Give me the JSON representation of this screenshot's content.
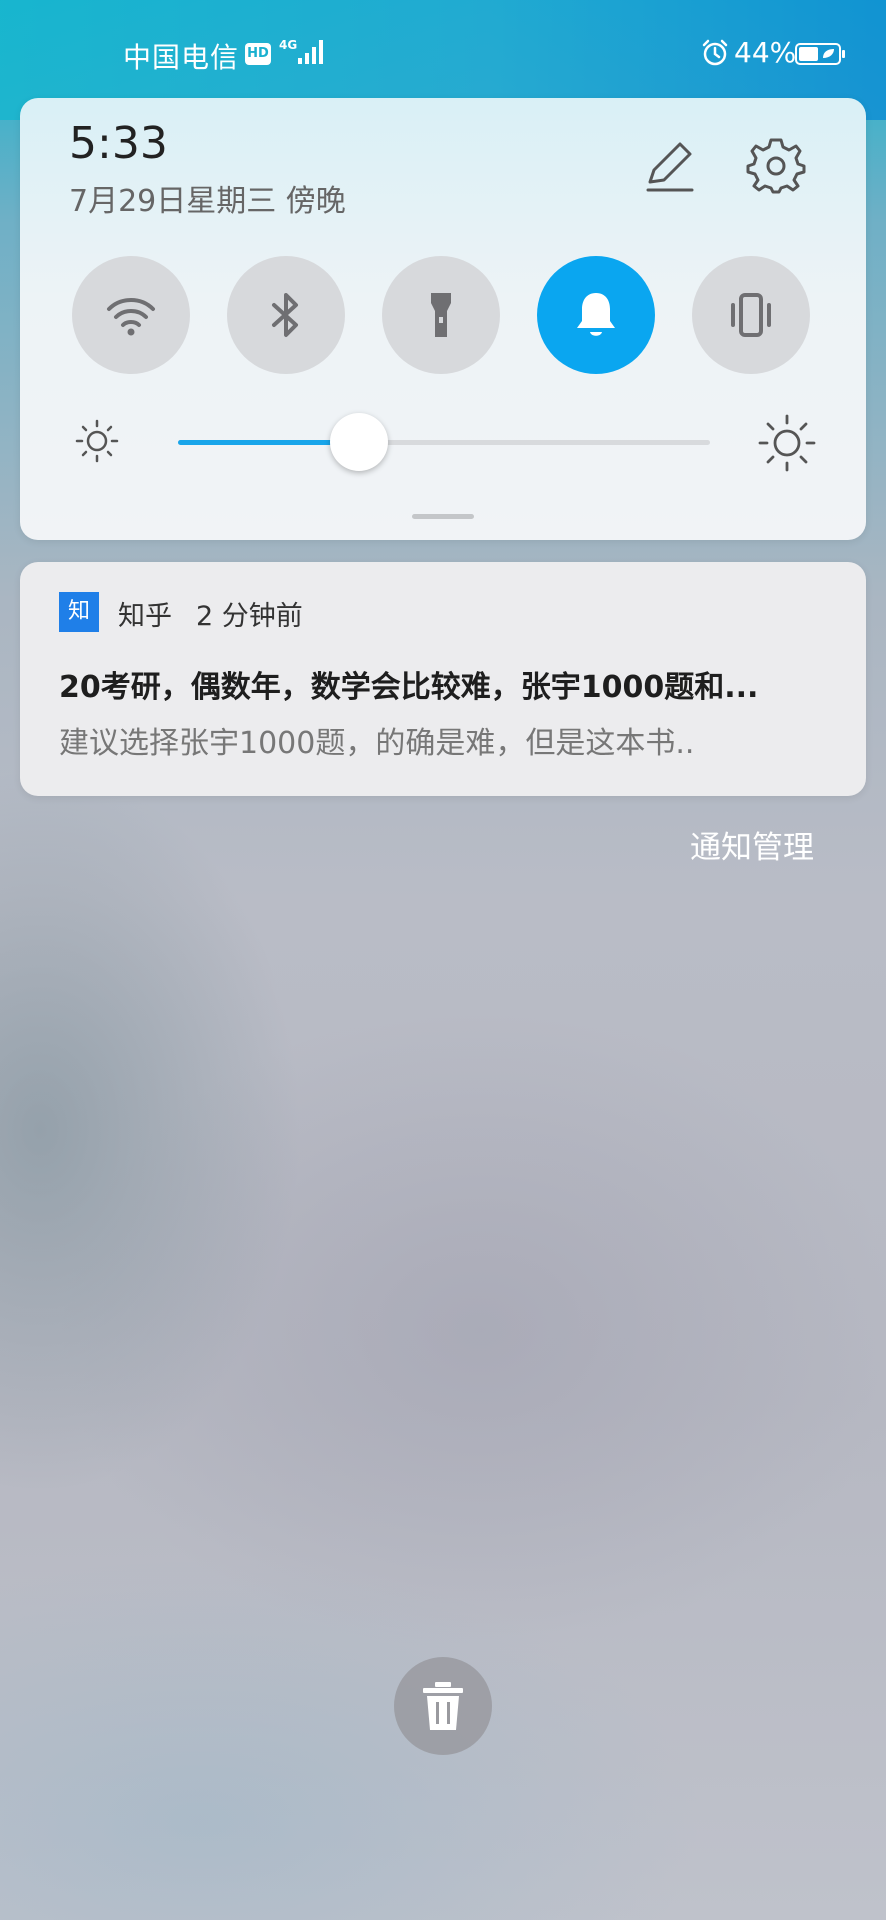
{
  "status_bar": {
    "carrier": "中国电信",
    "hd_badge": "HD",
    "network_type": "4G",
    "battery_percent": "44%",
    "icons": [
      "signal-icon",
      "alarm-icon",
      "battery-icon"
    ]
  },
  "quick_settings": {
    "time": "5:33",
    "date": "7月29日星期三 傍晚",
    "edit_icon": "pencil-icon",
    "settings_icon": "gear-icon",
    "toggles": [
      {
        "name": "wifi",
        "icon": "wifi-icon",
        "active": false
      },
      {
        "name": "bluetooth",
        "icon": "bluetooth-icon",
        "active": false
      },
      {
        "name": "flashlight",
        "icon": "flashlight-icon",
        "active": false
      },
      {
        "name": "sound",
        "icon": "bell-icon",
        "active": true
      },
      {
        "name": "vibrate",
        "icon": "vibrate-icon",
        "active": false
      }
    ],
    "brightness": 0.34,
    "accent_color": "#0aa6f0"
  },
  "notification": {
    "app_icon_text": "知",
    "app_name": "知乎",
    "time": "2 分钟前",
    "title": "20考研，偶数年，数学会比较难，张宇1000题和...",
    "body": "建议选择张宇1000题，的确是难，但是这本书.."
  },
  "manage_label": "通知管理",
  "clear_icon": "trash-icon"
}
